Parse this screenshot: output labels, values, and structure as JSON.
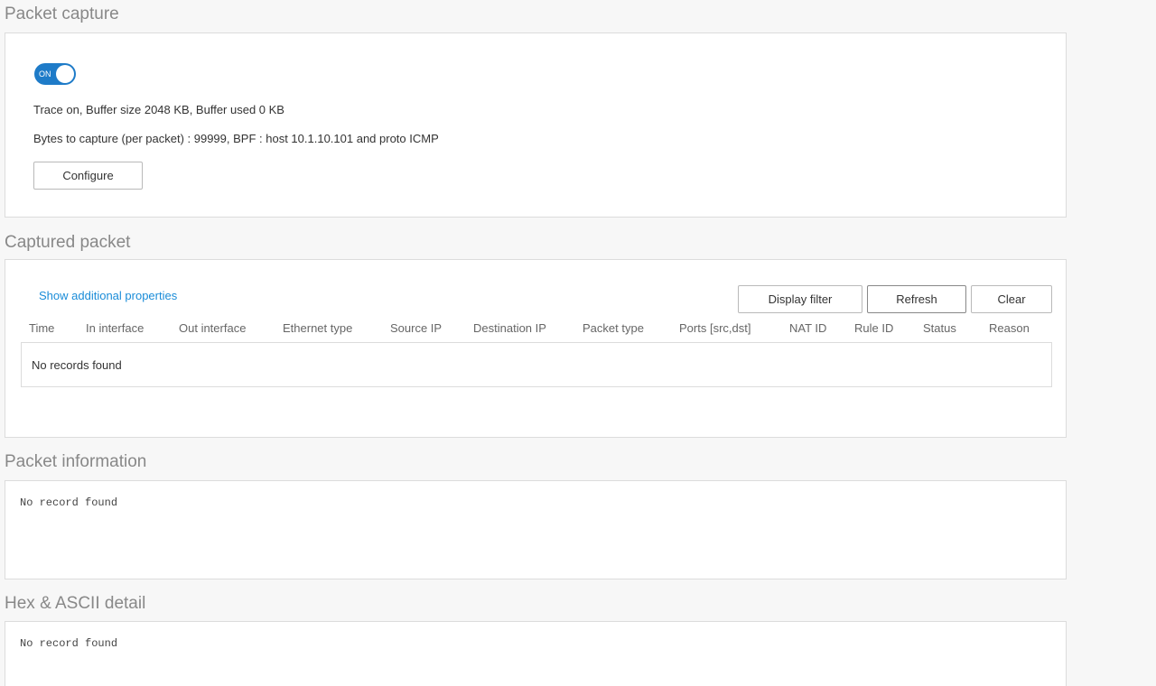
{
  "packet_capture": {
    "title": "Packet capture",
    "toggle_label": "ON",
    "toggle_state": "on",
    "trace_status": "Trace on, Buffer size 2048 KB, Buffer used 0 KB",
    "capture_settings": "Bytes to capture (per packet) : 99999, BPF : host 10.1.10.101 and proto ICMP",
    "configure_label": "Configure",
    "accent_color": "#1e7bc8"
  },
  "captured_packet": {
    "title": "Captured packet",
    "show_properties_label": "Show additional properties",
    "display_filter_label": "Display filter",
    "refresh_label": "Refresh",
    "clear_label": "Clear",
    "columns": [
      "Time",
      "In interface",
      "Out interface",
      "Ethernet type",
      "Source IP",
      "Destination IP",
      "Packet type",
      "Ports [src,dst]",
      "NAT ID",
      "Rule ID",
      "Status",
      "Reason"
    ],
    "empty_message": "No records found",
    "link_color": "#1a8cd8"
  },
  "packet_information": {
    "title": "Packet information",
    "empty_message": "No record found"
  },
  "hex_ascii_detail": {
    "title": "Hex & ASCII detail",
    "empty_message": "No record found"
  }
}
